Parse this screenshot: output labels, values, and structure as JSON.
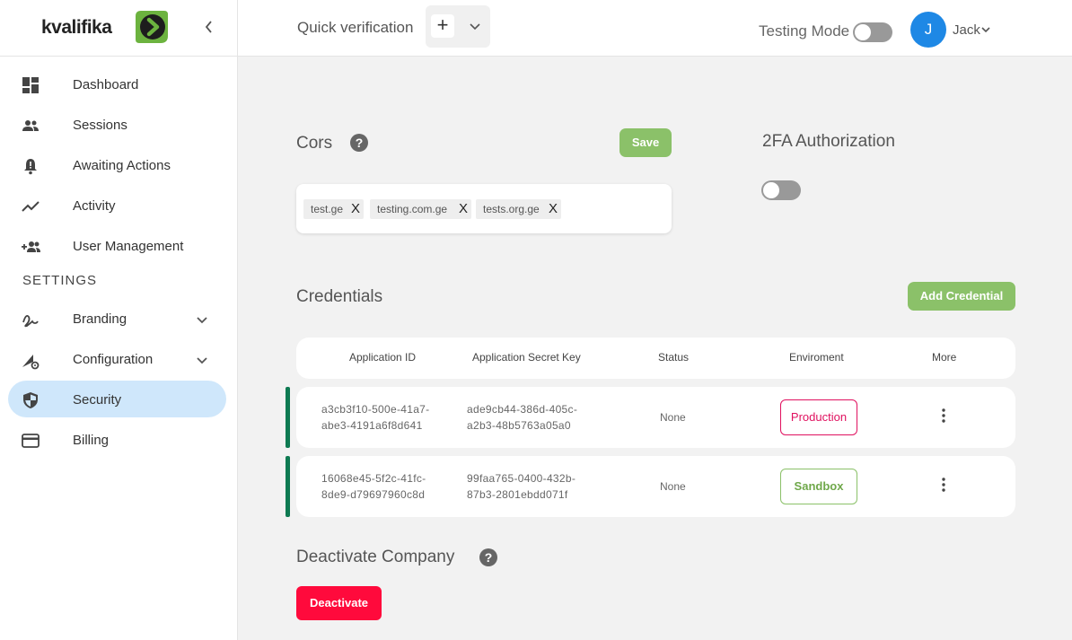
{
  "app": {
    "logo_text": "kvalifika"
  },
  "sidebar": {
    "items": [
      {
        "label": "Dashboard",
        "icon": "dashboard-icon"
      },
      {
        "label": "Sessions",
        "icon": "people-icon"
      },
      {
        "label": "Awaiting Actions",
        "icon": "bell-alert-icon"
      },
      {
        "label": "Activity",
        "icon": "activity-icon"
      },
      {
        "label": "User Management",
        "icon": "add-user-icon"
      }
    ],
    "settings_header": "SETTINGS",
    "settings_items": [
      {
        "label": "Branding",
        "icon": "signature-icon",
        "expandable": true
      },
      {
        "label": "Configuration",
        "icon": "config-icon",
        "expandable": true
      },
      {
        "label": "Security",
        "icon": "shield-icon",
        "active": true
      },
      {
        "label": "Billing",
        "icon": "card-icon"
      }
    ]
  },
  "topbar": {
    "quick_verification": "Quick verification",
    "plus": "+",
    "testing_mode_label": "Testing Mode",
    "testing_mode_on": false,
    "avatar_initial": "J",
    "user_name": "Jack"
  },
  "cors": {
    "title": "Cors",
    "help": "?",
    "save_label": "Save",
    "domains": [
      "test.ge",
      "testing.com.ge",
      "tests.org.ge"
    ],
    "remove_symbol": "X"
  },
  "twofa": {
    "title": "2FA Authorization",
    "enabled": false
  },
  "credentials": {
    "title": "Credentials",
    "add_label": "Add Credential",
    "columns": [
      "Application ID",
      "Application Secret Key",
      "Status",
      "Enviroment",
      "More"
    ],
    "rows": [
      {
        "app_id_1": "a3cb3f10-500e-41a7-",
        "app_id_2": "abe3-4191a6f8d641",
        "secret_1": "ade9cb44-386d-405c-",
        "secret_2": "a2b3-48b5763a05a0",
        "status": "None",
        "environment": "Production"
      },
      {
        "app_id_1": "16068e45-5f2c-41fc-",
        "app_id_2": "8de9-d79697960c8d",
        "secret_1": "99faa765-0400-432b-",
        "secret_2": "87b3-2801ebdd071f",
        "status": "None",
        "environment": "Sandbox"
      }
    ]
  },
  "deactivate": {
    "title": "Deactivate Company",
    "help": "?",
    "button_label": "Deactivate"
  },
  "colors": {
    "accent_green": "#8bc169",
    "danger": "#ff0a3c",
    "production": "#e0115f",
    "row_marker": "#0e7a52",
    "active_nav": "#cfe7fb"
  }
}
